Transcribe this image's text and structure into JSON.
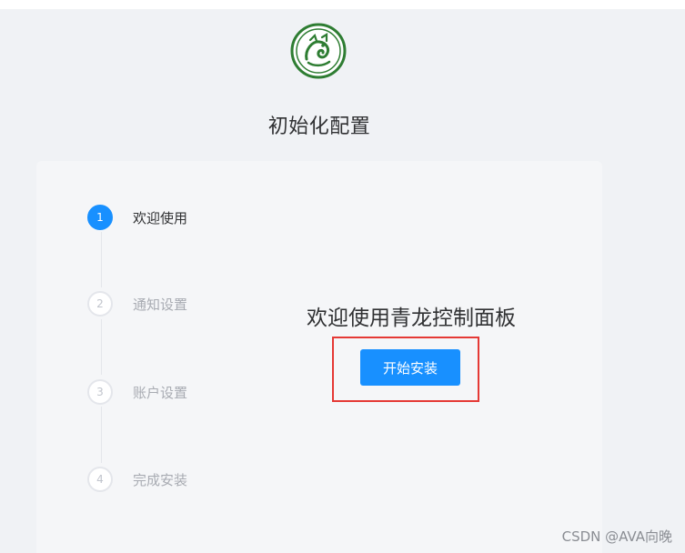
{
  "app": {
    "logo_icon": "qinglong-dragon-logo-icon",
    "title": "初始化配置"
  },
  "steps": [
    {
      "number": "1",
      "label": "欢迎使用",
      "active": true
    },
    {
      "number": "2",
      "label": "通知设置",
      "active": false
    },
    {
      "number": "3",
      "label": "账户设置",
      "active": false
    },
    {
      "number": "4",
      "label": "完成安装",
      "active": false
    }
  ],
  "main": {
    "welcome_text": "欢迎使用青龙控制面板",
    "start_button_label": "开始安装"
  },
  "colors": {
    "accent": "#1890ff",
    "highlight_border": "#e53935",
    "logo_green": "#2e7d32"
  },
  "watermark": "CSDN @AVA向晚"
}
